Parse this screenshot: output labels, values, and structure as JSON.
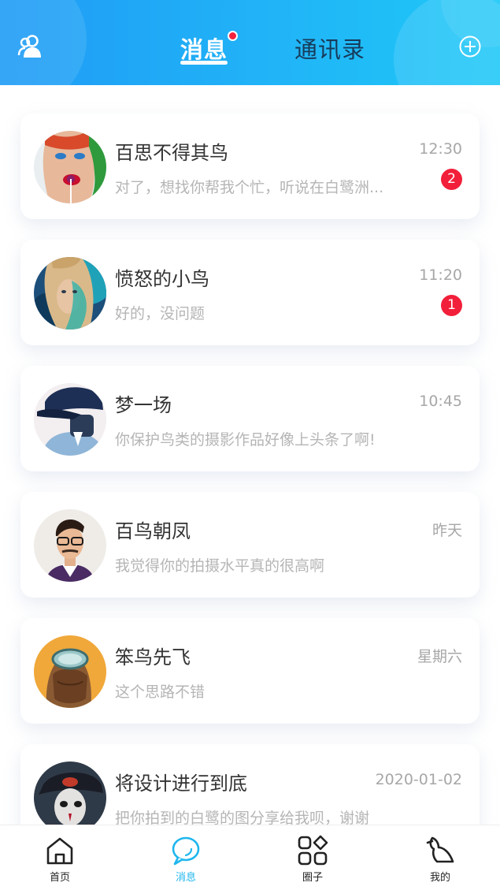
{
  "header": {
    "tabs": [
      {
        "label": "消息",
        "active": true,
        "has_dot": true
      },
      {
        "label": "通讯录",
        "active": false
      }
    ],
    "left_icon": "contacts-icon",
    "right_icon": "plus-circle-icon",
    "accent": "#1fa8f6"
  },
  "conversations": [
    {
      "name": "百思不得其鸟",
      "time": "12:30",
      "preview": "对了，想找你帮我个忙，听说在白鹭洲...",
      "unread": "2"
    },
    {
      "name": "愤怒的小鸟",
      "time": "11:20",
      "preview": "好的，没问题",
      "unread": "1"
    },
    {
      "name": "梦一场",
      "time": "10:45",
      "preview": "你保护鸟类的摄影作品好像上头条了啊!",
      "unread": null
    },
    {
      "name": "百鸟朝凤",
      "time": "昨天",
      "preview": "我觉得你的拍摄水平真的很高啊",
      "unread": null
    },
    {
      "name": "笨鸟先飞",
      "time": "星期六",
      "preview": "这个思路不错",
      "unread": null
    },
    {
      "name": "将设计进行到底",
      "time": "2020-01-02",
      "preview": "把你拍到的白鹭的图分享给我呗，谢谢",
      "unread": null
    }
  ],
  "tabbar": {
    "items": [
      {
        "label": "首页",
        "icon": "home-icon"
      },
      {
        "label": "消息",
        "icon": "chat-bubble-icon",
        "active": true
      },
      {
        "label": "圈子",
        "icon": "apps-grid-icon"
      },
      {
        "label": "我的",
        "icon": "bird-icon"
      }
    ],
    "active_color": "#1fb6ee"
  },
  "colors": {
    "badge": "#f21f3a",
    "name_text": "#333333",
    "preview_text": "#b5b5b5"
  }
}
